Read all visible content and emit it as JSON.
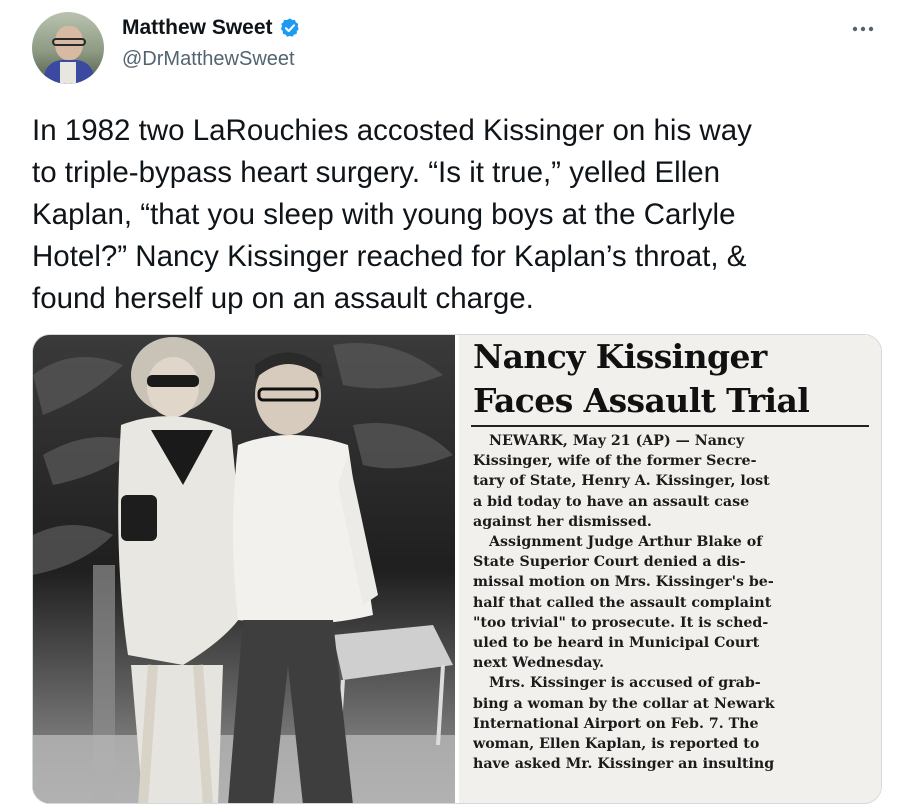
{
  "author": {
    "display_name": "Matthew Sweet",
    "handle": "@DrMatthewSweet",
    "verified_icon": "verified-badge-icon",
    "verified_color": "#1d9bf0"
  },
  "more_icon": "more-horizontal-icon",
  "tweet": {
    "text": "In 1982 two LaRouchies accosted Kissinger on his way\nto triple-bypass heart surgery. “Is it true,” yelled Ellen\nKaplan, “that you sleep with young boys at the Carlyle\nHotel?” Nancy Kissinger reached for Kaplan’s throat, &\nfound herself up on an assault charge."
  },
  "clipping": {
    "headline_line1": "Nancy Kissinger",
    "headline_line2": "Faces Assault Trial",
    "body": [
      "NEWARK, May 21 (AP) — Nancy",
      "Kissinger, wife of the former Secre-",
      "tary of State, Henry A. Kissinger, lost",
      "a bid today to have an assault case",
      "against her dismissed.",
      "Assignment Judge Arthur Blake of",
      "State Superior Court denied a dis-",
      "missal motion on Mrs. Kissinger's be-",
      "half that called the assault complaint",
      "\"too trivial\" to prosecute. It is sched-",
      "uled to be heard in Municipal Court",
      "next Wednesday.",
      "Mrs. Kissinger is accused of grab-",
      "bing a woman by the collar at Newark",
      "International Airport on Feb. 7. The",
      "woman, Ellen Kaplan, is reported to",
      "have asked Mr. Kissinger an insulting"
    ]
  }
}
